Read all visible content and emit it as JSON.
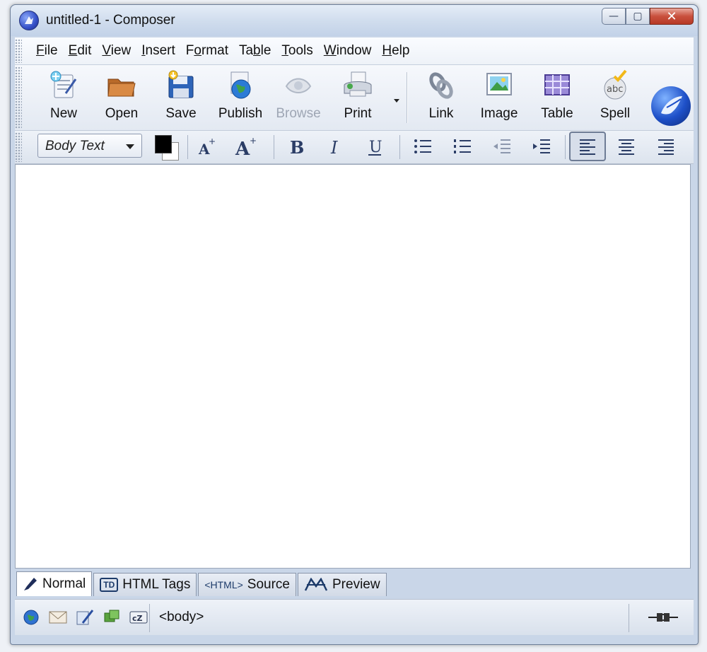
{
  "window": {
    "title": "untitled-1 - Composer",
    "controls": {
      "minimize": "—",
      "maximize": "▢",
      "close": "✕"
    }
  },
  "menubar": {
    "items": [
      {
        "label": "File",
        "mnemonic": "F",
        "rest": "ile"
      },
      {
        "label": "Edit",
        "mnemonic": "E",
        "rest": "dit"
      },
      {
        "label": "View",
        "mnemonic": "V",
        "rest": "iew"
      },
      {
        "label": "Insert",
        "mnemonic": "I",
        "rest": "nsert"
      },
      {
        "label": "Format",
        "pre": "F",
        "mnemonic": "o",
        "rest": "rmat"
      },
      {
        "label": "Table",
        "pre": "Ta",
        "mnemonic": "b",
        "rest": "le"
      },
      {
        "label": "Tools",
        "mnemonic": "T",
        "rest": "ools"
      },
      {
        "label": "Window",
        "mnemonic": "W",
        "rest": "indow"
      },
      {
        "label": "Help",
        "mnemonic": "H",
        "rest": "elp"
      }
    ]
  },
  "toolbar": {
    "new": "New",
    "open": "Open",
    "save": "Save",
    "publish": "Publish",
    "browse": "Browse",
    "print": "Print",
    "link": "Link",
    "image": "Image",
    "table": "Table",
    "spell": "Spell"
  },
  "format_toolbar": {
    "paragraph_style": "Body Text",
    "text_color": "#000000",
    "background_color": "#ffffff"
  },
  "editor_tabs": [
    {
      "label": "Normal",
      "icon": "pen-icon",
      "active": true
    },
    {
      "label": "HTML Tags",
      "icon": "td-tag-icon",
      "badge": "TD",
      "active": false
    },
    {
      "label": "Source",
      "icon": "html-source-icon",
      "badge": "<HTML>",
      "active": false
    },
    {
      "label": "Preview",
      "icon": "preview-icon",
      "active": false
    }
  ],
  "statusbar": {
    "tag_path": "<body>"
  },
  "colors": {
    "accent": "#3550c8",
    "close_button": "#c9503d"
  }
}
